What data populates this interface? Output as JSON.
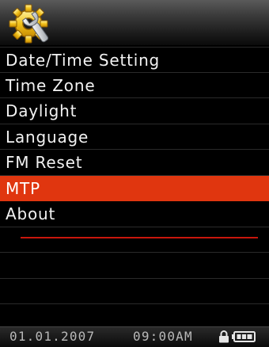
{
  "header": {
    "icon": "settings-wrench-gear-icon"
  },
  "menu": {
    "items": [
      {
        "label": "Date/Time Setting",
        "selected": false
      },
      {
        "label": "Time Zone",
        "selected": false
      },
      {
        "label": "Daylight",
        "selected": false
      },
      {
        "label": "Language",
        "selected": false
      },
      {
        "label": "FM Reset",
        "selected": false
      },
      {
        "label": "MTP",
        "selected": true
      },
      {
        "label": "About",
        "selected": false
      }
    ]
  },
  "status": {
    "date": "01.01.2007",
    "time": "09:00AM",
    "lock_icon": "lock-icon",
    "battery_icon": "battery-icon"
  },
  "colors": {
    "selection": "#e0360f",
    "divider": "#c8160c",
    "text": "#f2f2f2"
  }
}
